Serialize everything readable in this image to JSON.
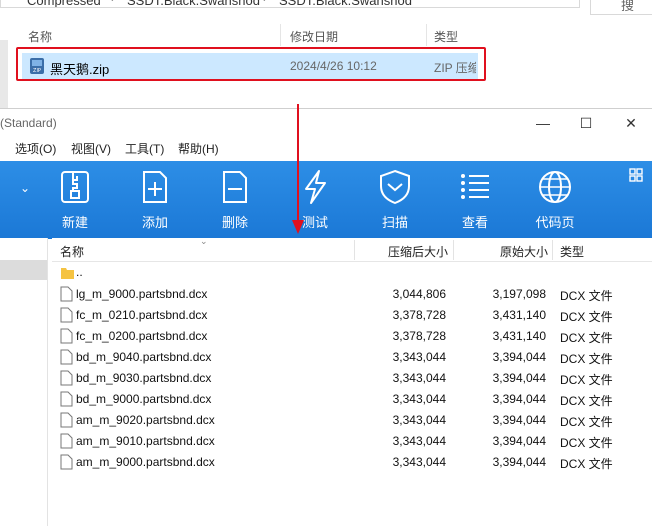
{
  "explorer": {
    "breadcrumb": [
      "Compressed",
      "SSDT.Black.Swanshod",
      "SSDT.Black.Swanshod"
    ],
    "search_placeholder": "搜",
    "columns": {
      "name": "名称",
      "date": "修改日期",
      "type": "类型"
    },
    "file": {
      "name": "黑天鹅.zip",
      "date": "2024/4/26 10:12",
      "type": "ZIP 压缩"
    }
  },
  "app": {
    "title": "(Standard)",
    "menus": [
      "选项(O)",
      "视图(V)",
      "工具(T)",
      "帮助(H)"
    ],
    "toolbar": [
      {
        "label": "新建",
        "icon": "new-archive-icon"
      },
      {
        "label": "添加",
        "icon": "add-icon"
      },
      {
        "label": "删除",
        "icon": "delete-icon"
      },
      {
        "label": "测试",
        "icon": "test-bolt-icon"
      },
      {
        "label": "扫描",
        "icon": "scan-shield-icon"
      },
      {
        "label": "查看",
        "icon": "view-list-icon"
      },
      {
        "label": "代码页",
        "icon": "codepage-globe-icon"
      }
    ],
    "list_columns": {
      "name": "名称",
      "packed": "压缩后大小",
      "original": "原始大小",
      "type": "类型"
    },
    "parent_dir": "..",
    "files": [
      {
        "name": "lg_m_9000.partsbnd.dcx",
        "packed": "3,044,806",
        "original": "3,197,098",
        "type": "DCX 文件"
      },
      {
        "name": "fc_m_0210.partsbnd.dcx",
        "packed": "3,378,728",
        "original": "3,431,140",
        "type": "DCX 文件"
      },
      {
        "name": "fc_m_0200.partsbnd.dcx",
        "packed": "3,378,728",
        "original": "3,431,140",
        "type": "DCX 文件"
      },
      {
        "name": "bd_m_9040.partsbnd.dcx",
        "packed": "3,343,044",
        "original": "3,394,044",
        "type": "DCX 文件"
      },
      {
        "name": "bd_m_9030.partsbnd.dcx",
        "packed": "3,343,044",
        "original": "3,394,044",
        "type": "DCX 文件"
      },
      {
        "name": "bd_m_9000.partsbnd.dcx",
        "packed": "3,343,044",
        "original": "3,394,044",
        "type": "DCX 文件"
      },
      {
        "name": "am_m_9020.partsbnd.dcx",
        "packed": "3,343,044",
        "original": "3,394,044",
        "type": "DCX 文件"
      },
      {
        "name": "am_m_9010.partsbnd.dcx",
        "packed": "3,343,044",
        "original": "3,394,044",
        "type": "DCX 文件"
      },
      {
        "name": "am_m_9000.partsbnd.dcx",
        "packed": "3,343,044",
        "original": "3,394,044",
        "type": "DCX 文件"
      }
    ]
  },
  "colors": {
    "toolbar": "#1b78d6",
    "highlight": "#e0101e",
    "selection": "#cce8ff",
    "folder": "#f5c342"
  }
}
